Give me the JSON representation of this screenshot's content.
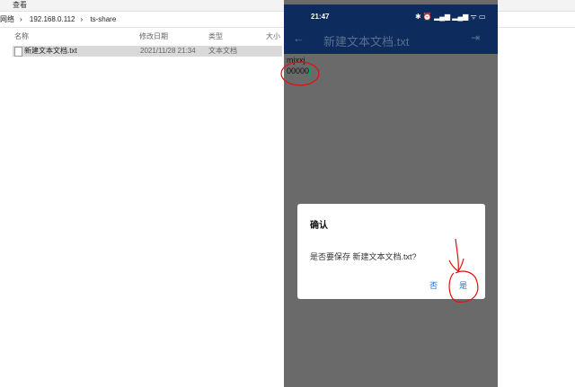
{
  "explorer": {
    "menu": "查看",
    "breadcrumb": [
      "网络",
      "192.168.0.112",
      "ts-share"
    ],
    "columns": {
      "name": "名称",
      "date": "修改日期",
      "type": "类型",
      "size": "大小"
    },
    "files": [
      {
        "name": "新建文本文档.txt",
        "date": "2021/11/28 21:34",
        "type": "文本文档"
      }
    ]
  },
  "phone": {
    "time": "21:47",
    "status_icons": "✱ ⏰ ▂▄▆ ▂▄▆ ᯤ ▭",
    "title": "新建文本文档.txt",
    "content": [
      "mjxxj",
      "00000"
    ],
    "dialog": {
      "title": "确认",
      "message": "是否要保存 新建文本文档.txt?",
      "no": "否",
      "yes": "是"
    }
  },
  "colors": {
    "header": "#0d2b5c",
    "accent": "#1e6fd9"
  }
}
